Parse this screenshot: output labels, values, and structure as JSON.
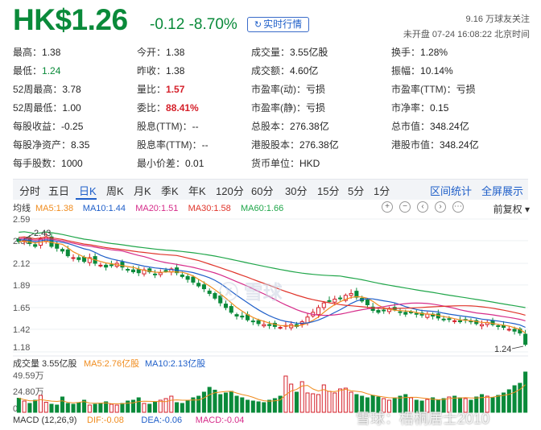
{
  "header": {
    "price": "HK$1.26",
    "change": "-0.12 -8.70%",
    "realtime_btn": "实时行情",
    "follow": "9.16 万球友关注",
    "market_status": "未开盘 07-24 16:08:22 北京时间"
  },
  "stats": [
    {
      "label": "最高：",
      "value": "1.38",
      "color": ""
    },
    {
      "label": "今开：",
      "value": "1.38",
      "color": ""
    },
    {
      "label": "成交量：",
      "value": "3.55亿股",
      "color": ""
    },
    {
      "label": "换手：",
      "value": "1.28%",
      "color": ""
    },
    {
      "label": "最低：",
      "value": "1.24",
      "color": "green"
    },
    {
      "label": "昨收：",
      "value": "1.38",
      "color": ""
    },
    {
      "label": "成交额：",
      "value": "4.60亿",
      "color": ""
    },
    {
      "label": "振幅：",
      "value": "10.14%",
      "color": ""
    },
    {
      "label": "52周最高：",
      "value": "3.78",
      "color": ""
    },
    {
      "label": "量比：",
      "value": "1.57",
      "color": "red"
    },
    {
      "label": "市盈率(动)：",
      "value": "亏损",
      "color": ""
    },
    {
      "label": "市盈率(TTM)：",
      "value": "亏损",
      "color": ""
    },
    {
      "label": "52周最低：",
      "value": "1.00",
      "color": ""
    },
    {
      "label": "委比：",
      "value": "88.41%",
      "color": "red"
    },
    {
      "label": "市盈率(静)：",
      "value": "亏损",
      "color": ""
    },
    {
      "label": "市净率：",
      "value": "0.15",
      "color": ""
    },
    {
      "label": "每股收益：",
      "value": "-0.25",
      "color": ""
    },
    {
      "label": "股息(TTM)：",
      "value": "--",
      "color": ""
    },
    {
      "label": "总股本：",
      "value": "276.38亿",
      "color": ""
    },
    {
      "label": "总市值：",
      "value": "348.24亿",
      "color": ""
    },
    {
      "label": "每股净资产：",
      "value": "8.35",
      "color": ""
    },
    {
      "label": "股息率(TTM)：",
      "value": "--",
      "color": ""
    },
    {
      "label": "港股股本：",
      "value": "276.38亿",
      "color": ""
    },
    {
      "label": "港股市值：",
      "value": "348.24亿",
      "color": ""
    },
    {
      "label": "每手股数：",
      "value": "1000",
      "color": ""
    },
    {
      "label": "最小价差：",
      "value": "0.01",
      "color": ""
    },
    {
      "label": "货币单位：",
      "value": "HKD",
      "color": ""
    }
  ],
  "tabs": [
    "分时",
    "五日",
    "日K",
    "周K",
    "月K",
    "季K",
    "年K",
    "120分",
    "60分",
    "30分",
    "15分",
    "5分",
    "1分"
  ],
  "active_tab": "日K",
  "right_tabs": [
    "区间统计",
    "全屏展示"
  ],
  "chart_tools": {
    "adjust": "前复权"
  },
  "ma_legend": {
    "label": "均线",
    "items": [
      {
        "text": "MA5:1.38",
        "color": "#f08c1e"
      },
      {
        "text": "MA10:1.44",
        "color": "#1f5fc9"
      },
      {
        "text": "MA20:1.51",
        "color": "#d62c8a"
      },
      {
        "text": "MA30:1.58",
        "color": "#e0342a"
      },
      {
        "text": "MA60:1.66",
        "color": "#20a64a"
      }
    ]
  },
  "volume_legend": {
    "label": "成交量 3.55亿股",
    "items": [
      {
        "text": "MA5:2.76亿股",
        "color": "#f08c1e"
      },
      {
        "text": "MA10:2.13亿股",
        "color": "#1f5fc9"
      }
    ],
    "ticks": [
      "49.59万",
      "24.80万",
      "0"
    ]
  },
  "macd_legend": {
    "label": "MACD (12,26,9)",
    "items": [
      {
        "text": "DIF:-0.08",
        "color": "#f08c1e"
      },
      {
        "text": "DEA:-0.06",
        "color": "#1f5fc9"
      },
      {
        "text": "MACD:-0.04",
        "color": "#d62c8a"
      }
    ]
  },
  "watermark": "雪球",
  "watermark_bottom": "雪球：梧桐居士2010",
  "colors": {
    "up": "#d5202a",
    "down": "#0a8a3a",
    "accent": "#1f5fc9"
  },
  "chart_data": {
    "type": "candlestick",
    "y_ticks": [
      "2.59",
      "2.36",
      "2.12",
      "1.89",
      "1.65",
      "1.42",
      "1.18"
    ],
    "ylim": [
      1.18,
      2.59
    ],
    "annotations": [
      {
        "text": "2.43",
        "type": "high"
      },
      {
        "text": "1.24",
        "type": "low"
      }
    ],
    "close": [
      2.35,
      2.36,
      2.33,
      2.3,
      2.38,
      2.4,
      2.3,
      2.28,
      2.25,
      2.2,
      2.18,
      2.16,
      2.14,
      2.18,
      2.12,
      2.1,
      2.08,
      2.1,
      2.12,
      2.08,
      2.05,
      2.03,
      2.02,
      2.05,
      2.03,
      2.0,
      2.02,
      2.04,
      2.06,
      2.02,
      1.98,
      1.95,
      1.92,
      1.88,
      1.85,
      1.8,
      1.75,
      1.7,
      1.65,
      1.6,
      1.56,
      1.55,
      1.52,
      1.5,
      1.48,
      1.47,
      1.46,
      1.45,
      1.44,
      1.46,
      1.47,
      1.45,
      1.5,
      1.55,
      1.6,
      1.65,
      1.7,
      1.72,
      1.74,
      1.75,
      1.78,
      1.8,
      1.76,
      1.72,
      1.68,
      1.62,
      1.6,
      1.62,
      1.64,
      1.63,
      1.6,
      1.58,
      1.6,
      1.58,
      1.57,
      1.58,
      1.56,
      1.54,
      1.52,
      1.53,
      1.51,
      1.5,
      1.52,
      1.5,
      1.48,
      1.47,
      1.49,
      1.47,
      1.45,
      1.44,
      1.42,
      1.4,
      1.38,
      1.26
    ],
    "volume": [
      0.35,
      0.28,
      0.22,
      0.3,
      0.42,
      0.25,
      0.2,
      0.18,
      0.38,
      0.22,
      0.2,
      0.24,
      0.3,
      0.18,
      0.2,
      0.22,
      0.26,
      0.2,
      0.18,
      0.22,
      0.28,
      0.3,
      0.36,
      0.22,
      0.2,
      0.26,
      0.3,
      0.34,
      0.4,
      0.24,
      0.22,
      0.3,
      0.36,
      0.4,
      0.5,
      0.62,
      0.55,
      0.44,
      0.48,
      0.52,
      0.4,
      0.36,
      0.3,
      0.28,
      0.26,
      0.24,
      0.3,
      0.34,
      0.4,
      0.9,
      0.7,
      0.5,
      0.76,
      0.48,
      0.46,
      0.44,
      0.68,
      0.52,
      0.48,
      0.58,
      0.6,
      0.5,
      0.44,
      0.4,
      0.36,
      0.42,
      0.38,
      0.34,
      0.3,
      0.36,
      0.4,
      0.44,
      0.36,
      0.3,
      0.28,
      0.32,
      0.36,
      0.3,
      0.34,
      0.38,
      0.4,
      0.36,
      0.34,
      0.3,
      0.38,
      0.44,
      0.4,
      0.36,
      0.42,
      0.48,
      0.56,
      0.66,
      0.72,
      1.0
    ]
  }
}
